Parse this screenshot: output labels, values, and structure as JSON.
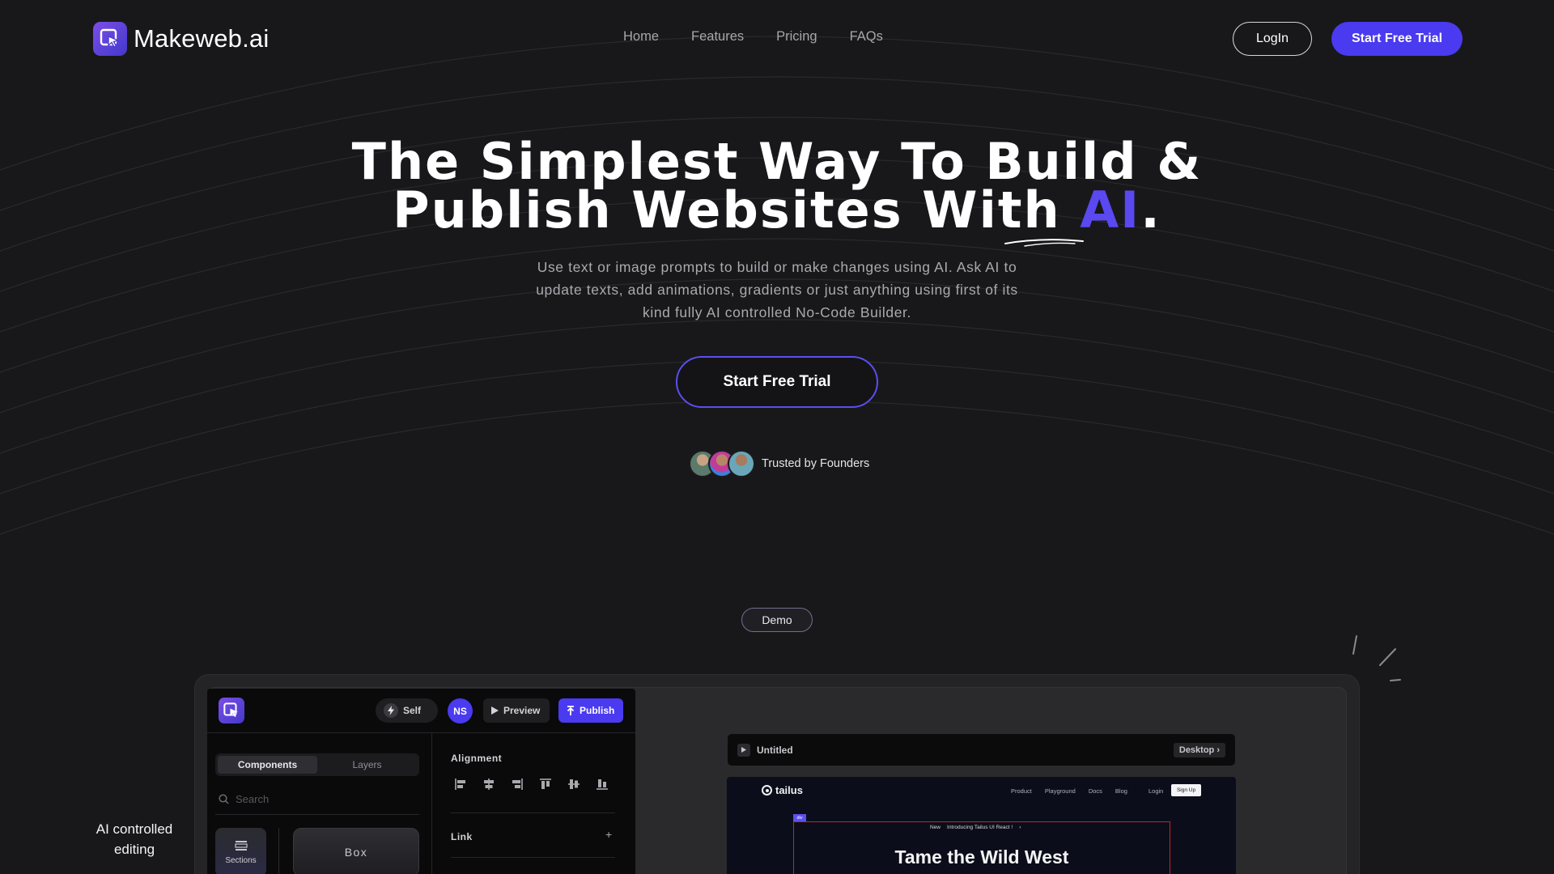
{
  "brand": {
    "name": "Makeweb.ai",
    "accent": "#4a3af0"
  },
  "nav": {
    "links": [
      "Home",
      "Features",
      "Pricing",
      "FAQs"
    ],
    "login_label": "LogIn",
    "cta_label": "Start Free Trial"
  },
  "hero": {
    "title_line1": "The Simplest Way To Build &",
    "title_line2_prefix": "Publish Websites With",
    "title_highlight": "AI",
    "title_suffix": ".",
    "subtitle": "Use text or image prompts to build or make changes using AI. Ask AI to update texts, add animations, gradients or just anything using first of its kind fully AI controlled No-Code Builder.",
    "cta_label": "Start Free Trial",
    "trusted_text": "Trusted by Founders"
  },
  "demo": {
    "badge": "Demo",
    "side_caption": "AI controlled editing",
    "editor": {
      "self_label": "Self",
      "user_initials": "NS",
      "preview_label": "Preview",
      "publish_label": "Publish",
      "tabs": [
        "Components",
        "Layers"
      ],
      "active_tab": "Components",
      "search_placeholder": "Search",
      "sections_label": "Sections",
      "box_label": "Box",
      "alignment_label": "Alignment",
      "link_label": "Link",
      "link_add": "+"
    },
    "preview": {
      "page_name": "Untitled",
      "device_label": "Desktop ›",
      "site_brand": "tailus",
      "site_nav": [
        "Product",
        "Playground",
        "Docs",
        "Blog"
      ],
      "site_login": "Login",
      "site_signup": "Sign Up",
      "selection_tag": "div",
      "announce_new": "New",
      "announce_text": "Introducing Tailus UI React !",
      "announce_arrow": "›",
      "heading": "Tame the Wild West"
    }
  }
}
